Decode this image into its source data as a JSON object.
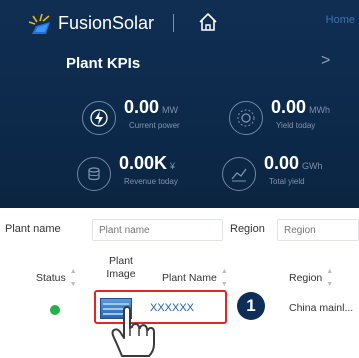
{
  "header": {
    "brand": "FusionSolar",
    "home_link": "Home",
    "home_icon": "home-icon",
    "logo_icon": "fusionsolar-logo"
  },
  "kpi_panel": {
    "title": "Plant KPIs",
    "more_glyph": ">",
    "items": [
      {
        "icon": "lightning-icon",
        "value": "0.00",
        "unit": "MW",
        "label": "Current power"
      },
      {
        "icon": "sun-yield-icon",
        "value": "0.00",
        "unit": "MWh",
        "label": "Yield today"
      },
      {
        "icon": "coins-icon",
        "value": "0.00K",
        "unit": "¥",
        "label": "Revenue today"
      },
      {
        "icon": "chart-yield-icon",
        "value": "0.00",
        "unit": "GWh",
        "label": "Total yield"
      }
    ]
  },
  "filters": {
    "plant_name_label": "Plant name",
    "plant_name_placeholder": "Plant name",
    "region_label": "Region",
    "region_placeholder": "Region"
  },
  "table": {
    "columns": [
      "Status",
      "Plant Image",
      "Plant Name",
      "Region"
    ],
    "status_col": "Status",
    "image_col_line1": "Plant",
    "image_col_line2": "Image",
    "name_col": "Plant Name",
    "region_col": "Region",
    "rows": [
      {
        "status": "online",
        "status_color": "#22b14c",
        "plant_name": "XXXXXX",
        "region": "China mainl..."
      }
    ]
  },
  "annotation": {
    "step_number": "1",
    "highlight_color": "#e2252b",
    "pointer_icon": "hand-pointer-icon"
  },
  "colors": {
    "dashboard_bg": "#0f2e52",
    "accent_link": "#1f5fbf",
    "status_online": "#22b14c"
  }
}
